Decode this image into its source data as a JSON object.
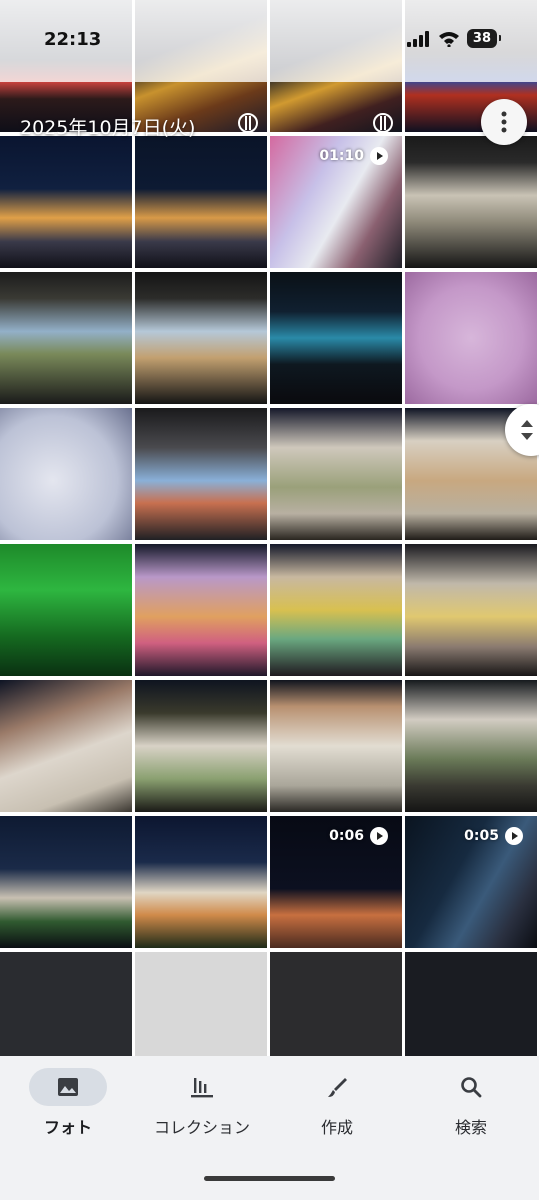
{
  "status": {
    "time": "22:13",
    "battery": "38"
  },
  "date_header": "2025年10月7日(火)",
  "grid": {
    "tiles": [
      {
        "bg": "linear-gradient(180deg,#1a2238 0%,#222a3a 45%,#c9423e 62%,#2c1a1a 75%,#0e0e18 100%)",
        "duration": ""
      },
      {
        "bg": "linear-gradient(160deg,#0d1020 0%,#0d1020 35%,#c8922e 55%,#6b3a1a 75%,#1a1a2a 100%)",
        "duration": ""
      },
      {
        "bg": "linear-gradient(160deg,#0d1222 0%,#0f1424 40%,#d19a30 60%,#402020 80%,#10141e 100%)",
        "duration": ""
      },
      {
        "bg": "linear-gradient(180deg,#0c0e18 0%,#1a1822 40%,#2b4aa0 60%,#b03020 72%,#0f1020 100%)",
        "duration": ""
      },
      {
        "bg": "linear-gradient(180deg,#0a1530 0%,#102040 40%,#e0a048 62%,#3a3a4a 80%,#101018 100%)",
        "duration": ""
      },
      {
        "bg": "linear-gradient(180deg,#0a1428 0%,#0d1a33 40%,#d89a48 62%,#3a3a4a 80%,#101018 100%)",
        "duration": ""
      },
      {
        "bg": "linear-gradient(120deg,#d46aa0 0%,#c7c0e8 35%,#e8eaf0 55%,#8a6070 75%,#202028 100%)",
        "duration": "01:10"
      },
      {
        "bg": "linear-gradient(180deg,#1a1a1a 0%,#2a2a2a 20%,#c9c3b5 45%,#8f8a7a 65%,#151515 100%)",
        "duration": ""
      },
      {
        "bg": "linear-gradient(180deg,#1c1c1c 0%,#3a3a34 20%,#93b0c8 45%,#7a8a5a 62%,#1a1a1a 100%)",
        "duration": ""
      },
      {
        "bg": "linear-gradient(180deg,#151515 0%,#2c2c2a 20%,#b5c8d8 45%,#c2a070 65%,#141414 100%)",
        "duration": ""
      },
      {
        "bg": "linear-gradient(180deg,#0a1016 0%,#102030 30%,#2a8aa8 50%,#0e1820 70%,#0a0a0e 100%)",
        "duration": ""
      },
      {
        "bg": "radial-gradient(circle at 50% 50%,#d7b6da 0%,#c498c8 55%,#9c6aa0 100%)",
        "duration": ""
      },
      {
        "bg": "radial-gradient(circle at 40% 55%,#e4e6ef 0%,#bcc2d6 60%,#6b7290 100%)",
        "duration": ""
      },
      {
        "bg": "linear-gradient(180deg,#1a1a1c 0%,#4a4a4e 30%,#8ab0d8 55%,#c87050 72%,#202024 100%)",
        "duration": ""
      },
      {
        "bg": "linear-gradient(180deg,#15182a 0%,#cfc8bc 30%,#9aa07a 60%,#b8b0a2 80%,#2a2620 100%)",
        "duration": ""
      },
      {
        "bg": "linear-gradient(180deg,#0f1424 0%,#d8d0c2 25%,#c8a880 55%,#b8b0a0 80%,#201c18 100%)",
        "duration": ""
      },
      {
        "bg": "linear-gradient(180deg,#1e8a2a 0%,#2eb640 35%,#156a20 70%,#0a3012 100%)",
        "duration": ""
      },
      {
        "bg": "linear-gradient(180deg,#141828 0%,#b898c8 25%,#e0a060 55%,#d06080 75%,#20182a 100%)",
        "duration": ""
      },
      {
        "bg": "linear-gradient(180deg,#14182a 0%,#c8b8a0 25%,#d8c050 50%,#6aa880 72%,#201a20 100%)",
        "duration": ""
      },
      {
        "bg": "linear-gradient(180deg,#1a1a20 0%,#c0b8aa 30%,#e0c870 55%,#8a7a70 78%,#181616 100%)",
        "duration": ""
      },
      {
        "bg": "linear-gradient(160deg,#0e1424 0%,#9a7a68 30%,#ddd6cc 55%,#c8c0b2 80%,#3a3630 100%)",
        "duration": ""
      },
      {
        "bg": "linear-gradient(180deg,#0e1420 0%,#3a3a2c 25%,#d8d2c6 50%,#8aa070 75%,#1a1a16 100%)",
        "duration": ""
      },
      {
        "bg": "linear-gradient(180deg,#10141e 0%,#b89070 20%,#e2ddd2 50%,#aaa69a 80%,#2a2824 100%)",
        "duration": ""
      },
      {
        "bg": "linear-gradient(180deg,#161a1e 0%,#d2ccc2 30%,#6a7a58 60%,#3a3a32 80%,#141414 100%)",
        "duration": ""
      },
      {
        "bg": "linear-gradient(180deg,#0e1a32 0%,#1a2a48 40%,#c8c0b2 62%,#305a30 80%,#0a0e12 100%)",
        "duration": ""
      },
      {
        "bg": "linear-gradient(180deg,#0c1630 0%,#1a2a4a 35%,#e0d6c4 58%,#d08a4a 75%,#1e2a18 100%)",
        "duration": ""
      },
      {
        "bg": "linear-gradient(180deg,#070a14 0%,#0c1020 55%,#c87040 75%,#4a2a20 100%)",
        "duration": "0:06"
      },
      {
        "bg": "linear-gradient(120deg,#0a1420 0%,#162a40 40%,#3a5a7a 60%,#2a3040 80%,#0a0c12 100%)",
        "duration": "0:05"
      },
      {
        "bg": "#2a2c30",
        "duration": ""
      },
      {
        "bg": "#d8d8d8",
        "duration": ""
      },
      {
        "bg": "#2c2c2e",
        "duration": ""
      },
      {
        "bg": "#1a1c22",
        "duration": ""
      }
    ]
  },
  "nav": [
    {
      "label": "フォト",
      "icon": "photo-icon",
      "active": true
    },
    {
      "label": "コレクション",
      "icon": "collections-icon",
      "active": false
    },
    {
      "label": "作成",
      "icon": "create-brush-icon",
      "active": false
    },
    {
      "label": "検索",
      "icon": "search-icon",
      "active": false
    }
  ]
}
